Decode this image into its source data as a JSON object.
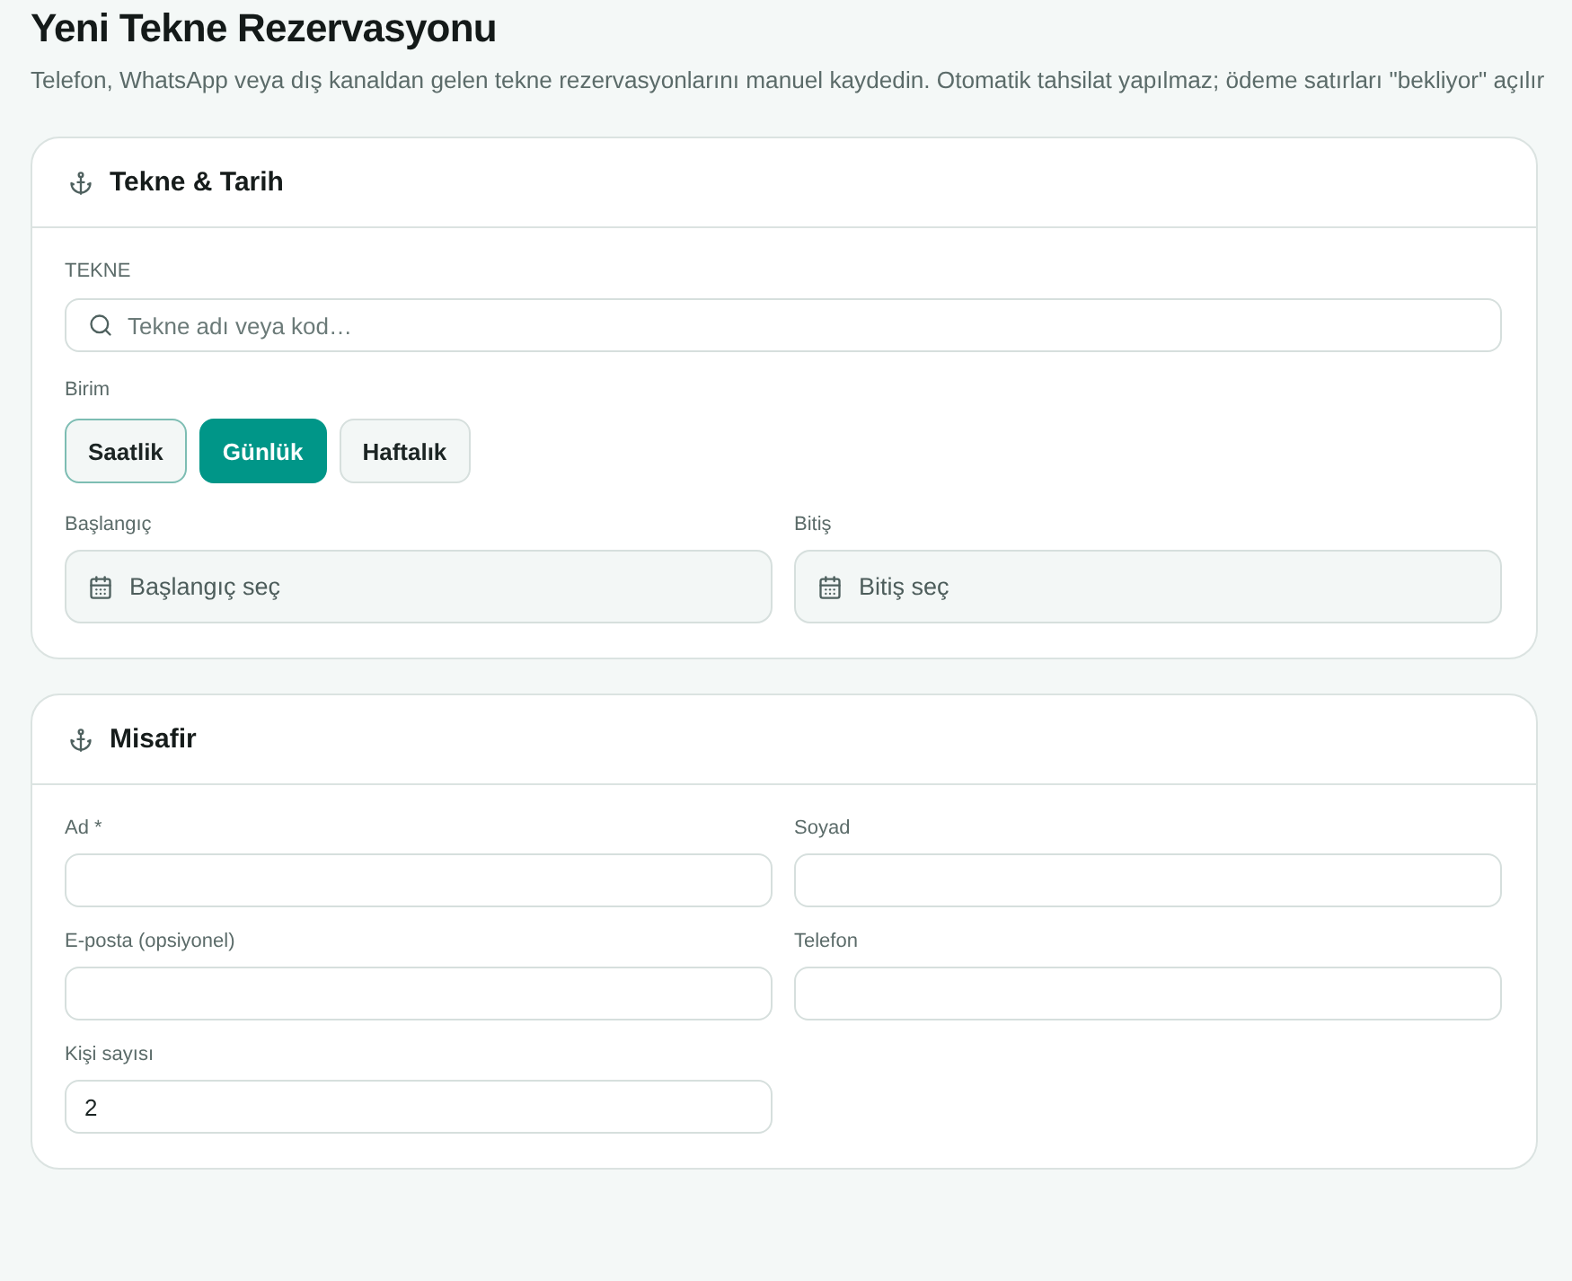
{
  "page": {
    "title": "Yeni Tekne Rezervasyonu",
    "subtitle": "Telefon, WhatsApp veya dış kanaldan gelen tekne rezervasyonlarını manuel kaydedin. Otomatik tahsilat yapılmaz; ödeme satırları \"bekliyor\" açılır"
  },
  "boat_section": {
    "title": "Tekne & Tarih",
    "boat": {
      "label": "TEKNE",
      "placeholder": "Tekne adı veya kod…"
    },
    "unit": {
      "label": "Birim",
      "options": [
        {
          "label": "Saatlik",
          "selected": false,
          "focused": true
        },
        {
          "label": "Günlük",
          "selected": true,
          "focused": false
        },
        {
          "label": "Haftalık",
          "selected": false,
          "focused": false
        }
      ]
    },
    "dates": [
      {
        "label": "Başlangıç",
        "placeholder": "Başlangıç seç"
      },
      {
        "label": "Bitiş",
        "placeholder": "Bitiş seç"
      }
    ]
  },
  "guest_section": {
    "title": "Misafir",
    "fields": [
      {
        "label": "Ad *"
      },
      {
        "label": "Soyad"
      },
      {
        "label": "E-posta (opsiyonel)"
      },
      {
        "label": "Telefon"
      },
      {
        "label": "Kişi sayısı",
        "value": "2"
      }
    ]
  }
}
